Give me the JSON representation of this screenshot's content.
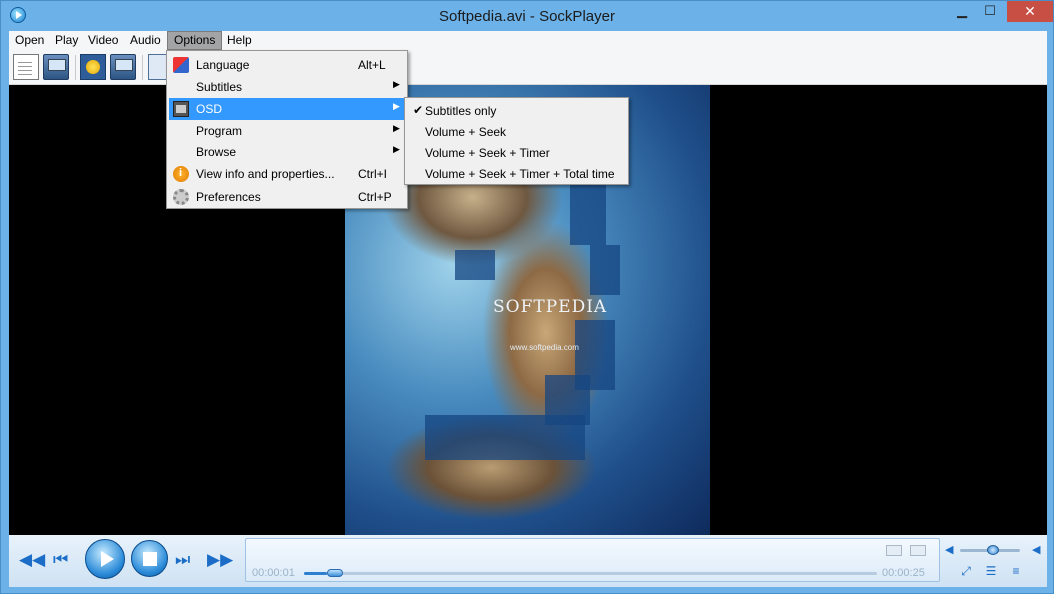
{
  "window": {
    "title": "Softpedia.avi - SockPlayer",
    "minimize_glyph": "▁",
    "maximize_glyph": "☐",
    "close_glyph": "✕"
  },
  "menubar": {
    "items": [
      "Open",
      "Play",
      "Video",
      "Audio",
      "Options",
      "Help"
    ],
    "active": "Options"
  },
  "options_menu": {
    "items": [
      {
        "label": "Language",
        "shortcut": "Alt+L",
        "icon": "language-icon",
        "submenu": false
      },
      {
        "label": "Subtitles",
        "shortcut": "",
        "icon": "",
        "submenu": true
      },
      {
        "label": "OSD",
        "shortcut": "",
        "icon": "osd-icon",
        "submenu": true,
        "highlighted": true
      },
      {
        "label": "Program",
        "shortcut": "",
        "icon": "",
        "submenu": true
      },
      {
        "label": "Browse",
        "shortcut": "",
        "icon": "",
        "submenu": true
      },
      {
        "label": "View info and properties...",
        "shortcut": "Ctrl+I",
        "icon": "info-icon",
        "submenu": false
      },
      {
        "label": "Preferences",
        "shortcut": "Ctrl+P",
        "icon": "gear-icon",
        "submenu": false
      }
    ],
    "submenu_arrow": "▶"
  },
  "osd_submenu": {
    "items": [
      {
        "label": "Subtitles only",
        "checked": true
      },
      {
        "label": "Volume + Seek",
        "checked": false
      },
      {
        "label": "Volume + Seek + Timer",
        "checked": false
      },
      {
        "label": "Volume + Seek + Timer + Total time",
        "checked": false
      }
    ],
    "check_glyph": "✔"
  },
  "video": {
    "overlay_title": "SOFTPEDIA",
    "overlay_url": "www.softpedia.com"
  },
  "playback": {
    "current_time": "00:00:01",
    "total_time": "00:00:25",
    "progress_fraction": 0.04,
    "volume_fraction": 0.55
  },
  "icons": {
    "rewind": "◀◀",
    "prev": "⏮",
    "next": "⏭",
    "forward": "▶▶",
    "fullscreen": "⤢",
    "playlist": "☰",
    "equalizer": "≡",
    "volume_min": "◀",
    "volume_max": "◀"
  },
  "colors": {
    "menu_highlight": "#3399ff",
    "accent": "#1b6dc7",
    "close_button": "#c74f43"
  }
}
